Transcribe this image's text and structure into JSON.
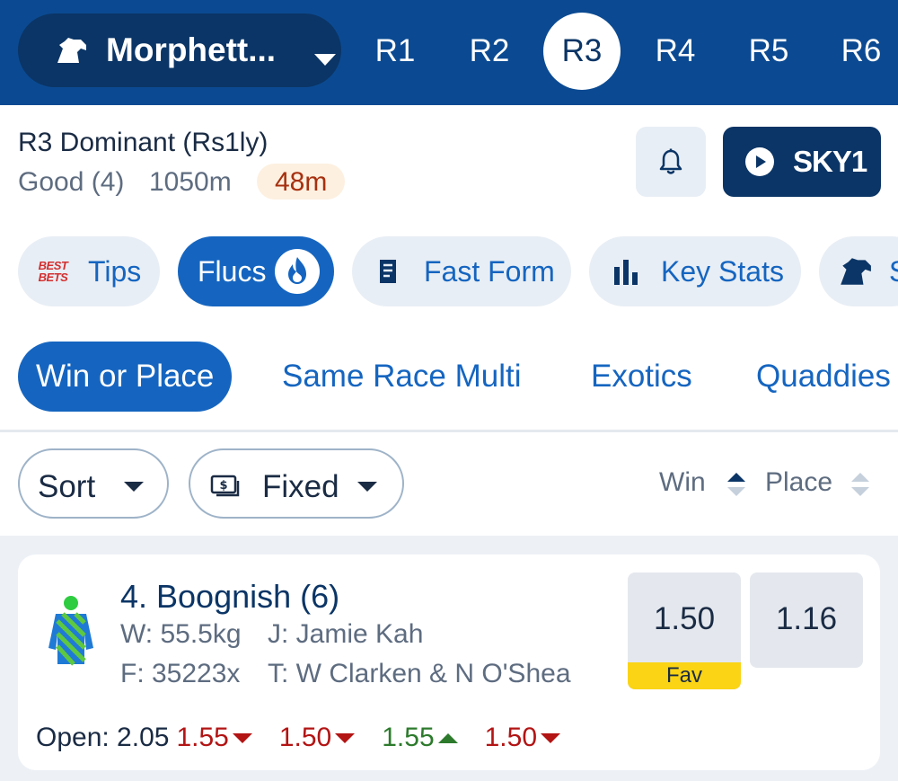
{
  "header": {
    "venue": "Morphett...",
    "venue_icon": "horse-head-icon",
    "races": [
      "R1",
      "R2",
      "R3",
      "R4",
      "R5",
      "R6"
    ],
    "active_race": "R3"
  },
  "race": {
    "title": "R3 Dominant (Rs1ly)",
    "track": "Good (4)",
    "distance": "1050m",
    "countdown": "48m",
    "stream_label": "SKY1",
    "bell_icon": "bell-icon",
    "play_icon": "play-icon"
  },
  "tools": [
    {
      "label": "Tips",
      "icon": "best-bets-icon",
      "icon_text": "BEST BETS",
      "active": false
    },
    {
      "label": "Flucs",
      "icon": "flame-icon",
      "active": true
    },
    {
      "label": "Fast Form",
      "icon": "form-document-icon",
      "active": false
    },
    {
      "label": "Key Stats",
      "icon": "bar-chart-icon",
      "active": false
    },
    {
      "label": "S",
      "icon": "horse-head-icon",
      "active": false
    }
  ],
  "bet_tabs": [
    {
      "label": "Win or Place",
      "active": true
    },
    {
      "label": "Same Race Multi",
      "active": false
    },
    {
      "label": "Exotics",
      "active": false
    },
    {
      "label": "Quaddies",
      "active": false
    }
  ],
  "filters": {
    "sort_label": "Sort",
    "price_type_label": "Fixed",
    "price_type_icon": "cash-icon",
    "win_header": "Win",
    "place_header": "Place"
  },
  "runners": [
    {
      "name": "4. Boognish (6)",
      "weight": "W: 55.5kg",
      "jockey": "J: Jamie Kah",
      "form": "F: 35223x",
      "trainer": "T: W Clarken & N O'Shea",
      "win_odds": "1.50",
      "place_odds": "1.16",
      "badge": "Fav",
      "flucs": {
        "open_label": "Open: 2.05",
        "moves": [
          {
            "value": "1.55",
            "direction": "down"
          },
          {
            "value": "1.50",
            "direction": "down"
          },
          {
            "value": "1.55",
            "direction": "up"
          },
          {
            "value": "1.50",
            "direction": "down"
          }
        ]
      }
    }
  ],
  "colors": {
    "brand_dark": "#0b3566",
    "brand": "#0b4a92",
    "accent": "#1565c0",
    "fav": "#fad415",
    "fluc_down": "#b31414",
    "fluc_up": "#2d7a2d",
    "countdown_bg": "#fdf0e0",
    "countdown_text": "#a6300f"
  }
}
